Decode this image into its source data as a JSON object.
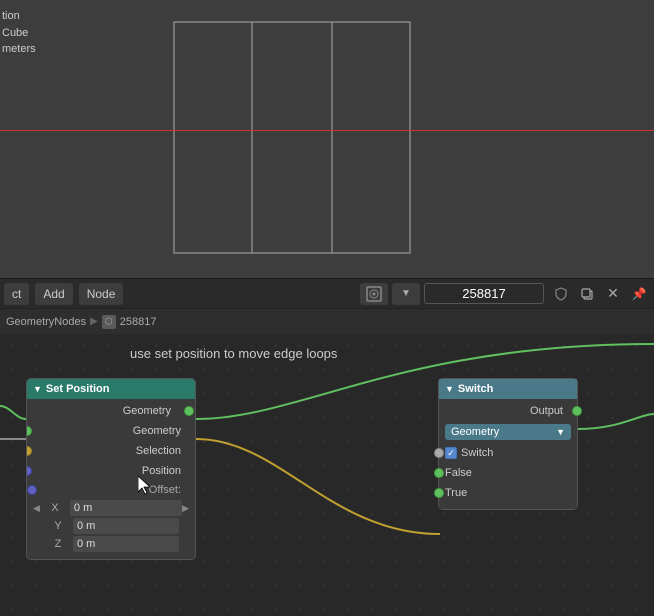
{
  "viewport": {
    "mode": "Orthographic",
    "object": "Cube",
    "panel": "tion",
    "params": "meters",
    "cube_label": "Cube"
  },
  "toolbar": {
    "object_label": "ct",
    "add_label": "Add",
    "node_label": "Node",
    "scene_id": "258817",
    "pin_icon": "📌"
  },
  "breadcrumb": {
    "root": "GeometryNodes",
    "separator": "▶",
    "node_id": "258817"
  },
  "hint": "use set position to move edge loops",
  "nodes": {
    "set_position": {
      "title": "Set Position",
      "inputs": [
        {
          "label": "Geometry",
          "socket": "green"
        },
        {
          "label": "Selection",
          "socket": "yellow"
        },
        {
          "label": "Position",
          "socket": "blue"
        },
        {
          "label": "Offset:",
          "socket": null
        }
      ],
      "offset_x": "0 m",
      "offset_y": "0 m",
      "offset_z": "0 m"
    },
    "switch": {
      "title": "Switch",
      "output_label": "Output",
      "geometry_dropdown": "Geometry",
      "switch_label": "Switch",
      "false_label": "False",
      "true_label": "True"
    }
  }
}
